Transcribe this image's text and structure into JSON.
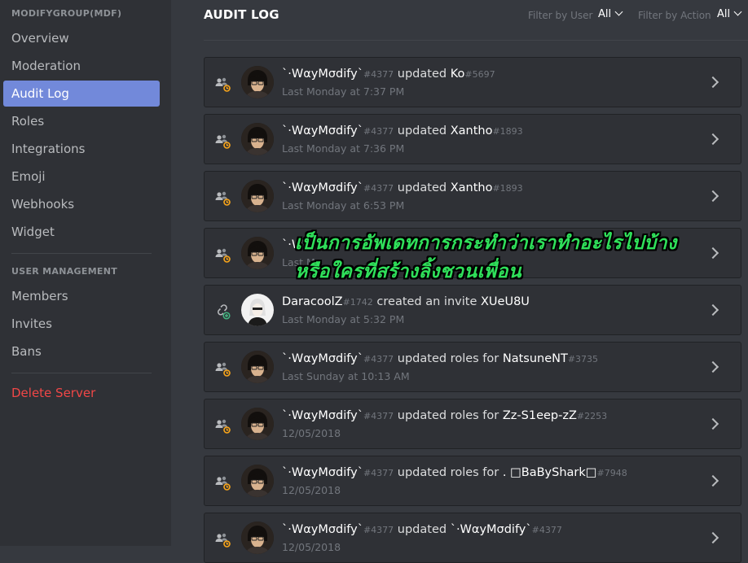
{
  "sidebar": {
    "server_header": "MODIFYGROUP(MDF)",
    "items": [
      {
        "label": "Overview"
      },
      {
        "label": "Moderation"
      },
      {
        "label": "Audit Log"
      },
      {
        "label": "Roles"
      },
      {
        "label": "Integrations"
      },
      {
        "label": "Emoji"
      },
      {
        "label": "Webhooks"
      },
      {
        "label": "Widget"
      }
    ],
    "user_management_header": "USER MANAGEMENT",
    "user_items": [
      {
        "label": "Members"
      },
      {
        "label": "Invites"
      },
      {
        "label": "Bans"
      }
    ],
    "delete_label": "Delete Server"
  },
  "main": {
    "title": "AUDIT LOG",
    "filter_user_label": "Filter by User",
    "filter_user_value": "All",
    "filter_action_label": "Filter by Action",
    "filter_action_value": "All"
  },
  "entries": [
    {
      "icon": "member-update-icon",
      "user": "`·WαyMσdify`",
      "user_disc": "#4377",
      "action": "updated",
      "target": "Ko",
      "target_disc": "#5697",
      "time": "Last Monday at 7:37 PM"
    },
    {
      "icon": "member-update-icon",
      "user": "`·WαyMσdify`",
      "user_disc": "#4377",
      "action": "updated",
      "target": "Xantho",
      "target_disc": "#1893",
      "time": "Last Monday at 7:36 PM"
    },
    {
      "icon": "member-update-icon",
      "user": "`·WαyMσdify`",
      "user_disc": "#4377",
      "action": "updated",
      "target": "Xantho",
      "target_disc": "#1893",
      "time": "Last Monday at 6:53 PM"
    },
    {
      "icon": "member-update-icon",
      "user": "`·W",
      "user_disc": "",
      "action": "",
      "target": "",
      "target_disc": "",
      "time": "Last M"
    },
    {
      "icon": "invite-create-icon",
      "user": "DaracoolZ",
      "user_disc": "#1742",
      "action": "created an invite",
      "target": "XUeU8U",
      "target_disc": "",
      "time": "Last Monday at 5:32 PM"
    },
    {
      "icon": "member-update-icon",
      "user": "`·WαyMσdify`",
      "user_disc": "#4377",
      "action": "updated roles for",
      "target": "NatsuneNT",
      "target_disc": "#3735",
      "time": "Last Sunday at 10:13 AM"
    },
    {
      "icon": "member-update-icon",
      "user": "`·WαyMσdify`",
      "user_disc": "#4377",
      "action": "updated roles for",
      "target": "Zz-S1eep-zZ",
      "target_disc": "#2253",
      "time": "12/05/2018"
    },
    {
      "icon": "member-update-icon",
      "user": "`·WαyMσdify`",
      "user_disc": "#4377",
      "action": "updated roles for",
      "target": ". □BaByShark□",
      "target_disc": "#7948",
      "time": "12/05/2018"
    },
    {
      "icon": "member-update-icon",
      "user": "`·WαyMσdify`",
      "user_disc": "#4377",
      "action": "updated",
      "target": "`·WαyMσdify`",
      "target_disc": "#4377",
      "time": "12/05/2018"
    }
  ],
  "overlay": {
    "line1": "เป็นการอัพเดทการกระทำว่าเราทำอะไรไปบ้าง",
    "line2": "หรือใครที่สร้างลิ้งชวนเพื่อน"
  },
  "colors": {
    "accent": "#7289da",
    "danger": "#f04747",
    "overlay_text": "#2fe05a"
  }
}
